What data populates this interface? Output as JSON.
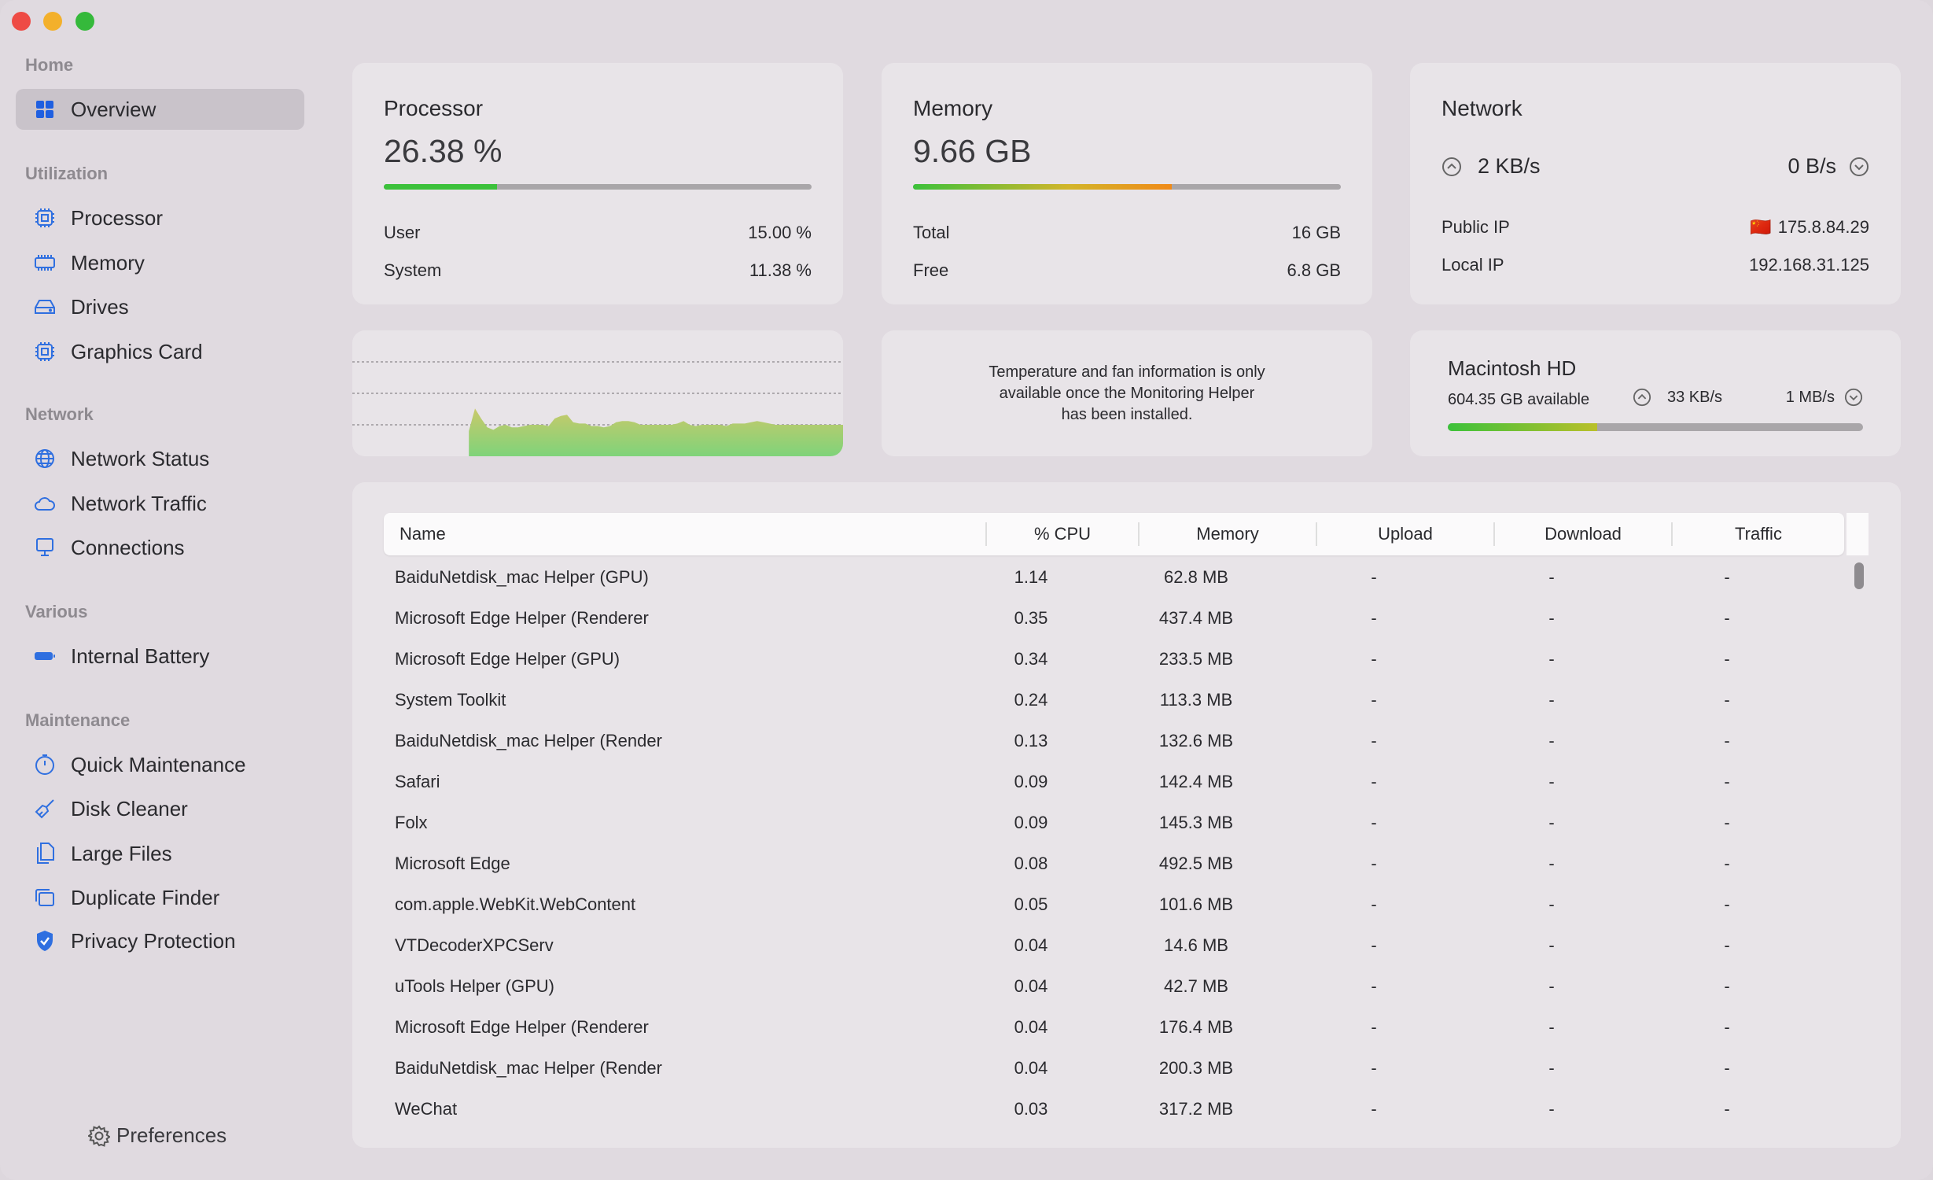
{
  "sidebar": {
    "sections": {
      "home": "Home",
      "utilization": "Utilization",
      "network": "Network",
      "various": "Various",
      "maintenance": "Maintenance"
    },
    "items": {
      "overview": "Overview",
      "processor": "Processor",
      "memory": "Memory",
      "drives": "Drives",
      "graphics": "Graphics Card",
      "network_status": "Network Status",
      "network_traffic": "Network Traffic",
      "connections": "Connections",
      "battery": "Internal Battery",
      "quick_maintenance": "Quick Maintenance",
      "disk_cleaner": "Disk Cleaner",
      "large_files": "Large Files",
      "duplicate_finder": "Duplicate Finder",
      "privacy": "Privacy Protection"
    },
    "selected": "overview",
    "preferences": "Preferences"
  },
  "processor": {
    "title": "Processor",
    "value": "26.38 %",
    "usage_percent": 26.38,
    "user_label": "User",
    "user_value": "15.00 %",
    "system_label": "System",
    "system_value": "11.38 %"
  },
  "memory": {
    "title": "Memory",
    "value": "9.66 GB",
    "usage_percent": 60.4,
    "total_label": "Total",
    "total_value": "16 GB",
    "free_label": "Free",
    "free_value": "6.8 GB"
  },
  "network": {
    "title": "Network",
    "upload": "2 KB/s",
    "download": "0 B/s",
    "public_ip_label": "Public IP",
    "public_ip_flag": "🇨🇳",
    "public_ip": "175.8.84.29",
    "local_ip_label": "Local IP",
    "local_ip": "192.168.31.125"
  },
  "temperature": {
    "message": "Temperature and fan information is only available once the Monitoring Helper has been installed."
  },
  "disk": {
    "title": "Macintosh HD",
    "available": "604.35 GB available",
    "read": "33 KB/s",
    "write": "1 MB/s",
    "used_percent": 36
  },
  "chart_data": {
    "type": "area",
    "ylim": [
      0,
      100
    ],
    "grid_lines": [
      25,
      50,
      75
    ],
    "color": "#7fd37a",
    "values": [
      null,
      null,
      null,
      null,
      null,
      null,
      null,
      null,
      null,
      null,
      null,
      null,
      null,
      null,
      null,
      null,
      null,
      null,
      null,
      20,
      38,
      30,
      23,
      21,
      24,
      25,
      23,
      23,
      24,
      25,
      25,
      25,
      24,
      30,
      32,
      33,
      27,
      26,
      26,
      24,
      24,
      23,
      24,
      27,
      28,
      28,
      27,
      25,
      25,
      25,
      25,
      25,
      25,
      26,
      28,
      25,
      24,
      25,
      25,
      25,
      25,
      24,
      26,
      26,
      26,
      27,
      28,
      27,
      26,
      25,
      25,
      25,
      25,
      25,
      25,
      25,
      25,
      25,
      25,
      25,
      25
    ]
  },
  "colors": {
    "accent": "#2f6fe0",
    "bar_track": "#a9a6a9",
    "green": "#3cc13b",
    "yellow": "#d2b52a",
    "orange": "#f08a18"
  },
  "table": {
    "columns": [
      "Name",
      "% CPU",
      "Memory",
      "Upload",
      "Download",
      "Traffic"
    ],
    "rows": [
      [
        "BaiduNetdisk_mac Helper (GPU)",
        "1.14",
        "62.8 MB",
        "-",
        "-",
        "-"
      ],
      [
        "Microsoft Edge Helper (Renderer",
        "0.35",
        "437.4 MB",
        "-",
        "-",
        "-"
      ],
      [
        "Microsoft Edge Helper (GPU)",
        "0.34",
        "233.5 MB",
        "-",
        "-",
        "-"
      ],
      [
        "System Toolkit",
        "0.24",
        "113.3 MB",
        "-",
        "-",
        "-"
      ],
      [
        "BaiduNetdisk_mac Helper (Render",
        "0.13",
        "132.6 MB",
        "-",
        "-",
        "-"
      ],
      [
        "Safari",
        "0.09",
        "142.4 MB",
        "-",
        "-",
        "-"
      ],
      [
        "Folx",
        "0.09",
        "145.3 MB",
        "-",
        "-",
        "-"
      ],
      [
        "Microsoft Edge",
        "0.08",
        "492.5 MB",
        "-",
        "-",
        "-"
      ],
      [
        "com.apple.WebKit.WebContent",
        "0.05",
        "101.6 MB",
        "-",
        "-",
        "-"
      ],
      [
        "VTDecoderXPCServ",
        "0.04",
        "14.6 MB",
        "-",
        "-",
        "-"
      ],
      [
        "uTools Helper (GPU)",
        "0.04",
        "42.7 MB",
        "-",
        "-",
        "-"
      ],
      [
        "Microsoft Edge Helper (Renderer",
        "0.04",
        "176.4 MB",
        "-",
        "-",
        "-"
      ],
      [
        "BaiduNetdisk_mac Helper (Render",
        "0.04",
        "200.3 MB",
        "-",
        "-",
        "-"
      ],
      [
        "WeChat",
        "0.03",
        "317.2 MB",
        "-",
        "-",
        "-"
      ]
    ]
  }
}
